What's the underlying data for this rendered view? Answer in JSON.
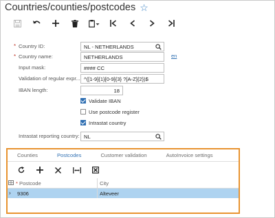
{
  "window": {
    "title": "Countries/counties/postcodes"
  },
  "toolbar": {
    "buttons": [
      "save-icon",
      "undo-icon",
      "add-icon",
      "delete-icon",
      "clipboard-icon",
      "first-record-icon",
      "previous-record-icon",
      "next-record-icon",
      "last-record-icon"
    ]
  },
  "form": {
    "country_id": {
      "label": "Country ID:",
      "value": "NL - NETHERLANDS"
    },
    "country_name": {
      "label": "Country name:",
      "value": "NETHERLANDS",
      "lang_link": "en"
    },
    "input_mask": {
      "label": "Input mask:",
      "value": "#### CC"
    },
    "validation_regex": {
      "label": "Validation of regular expr...",
      "value": "^([1-9]{1}[0-9]{3} ?[A-Z]{2})$"
    },
    "iban_length": {
      "label": "IBAN length:",
      "value": "18"
    },
    "validate_iban": {
      "label": "Validate IBAN",
      "checked": true
    },
    "use_postcode_register": {
      "label": "Use postcode register",
      "checked": false
    },
    "intrastat_country": {
      "label": "Intrastat country",
      "checked": true
    },
    "intrastat_reporting_country": {
      "label": "Intrastat reporting country:",
      "value": "NL"
    }
  },
  "tabs": [
    {
      "label": "Counties",
      "active": false
    },
    {
      "label": "Postcodes",
      "active": true
    },
    {
      "label": "Customer validation",
      "active": false
    },
    {
      "label": "AutoInvoice settings",
      "active": false
    }
  ],
  "grid": {
    "columns": {
      "postcode": "Postcode",
      "city": "City"
    },
    "rows": [
      {
        "postcode": "9306",
        "city": "Alteveer"
      }
    ]
  },
  "colors": {
    "accent": "#2f6fb2",
    "highlight_border": "#e8922e",
    "selected_row": "#aed3f0",
    "required": "#c0392b"
  }
}
